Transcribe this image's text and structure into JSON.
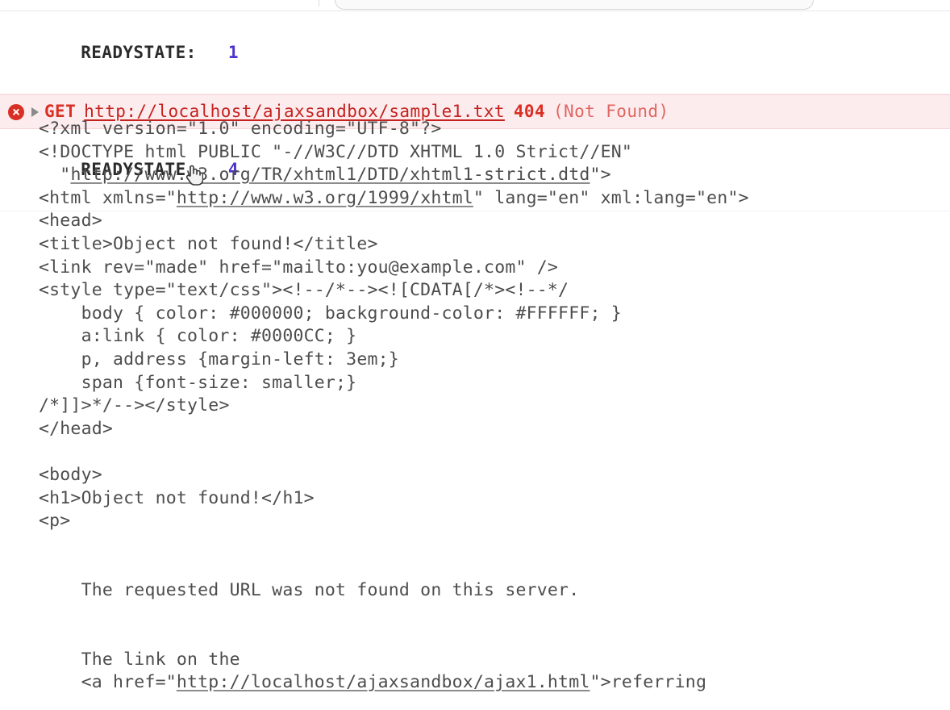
{
  "toolbar": {
    "filter_input_value": "",
    "filter_input_placeholder": ""
  },
  "console": {
    "rows": [
      {
        "type": "log",
        "label": "READYSTATE:",
        "value": "1"
      },
      {
        "type": "error",
        "icon": "error-circle-icon",
        "disclosure": "disclosure-triangle-icon",
        "method": "GET",
        "url": "http://localhost/ajaxsandbox/sample1.txt",
        "status_code": "404",
        "status_text": "(Not Found)"
      },
      {
        "type": "log",
        "label": "READYSTATE:",
        "value": "4"
      }
    ]
  },
  "source_dump": {
    "lines": [
      {
        "text": "<?xml version=\"1.0\" encoding=\"UTF-8\"?>"
      },
      {
        "text": "<!DOCTYPE html PUBLIC \"-//W3C//DTD XHTML 1.0 Strict//EN\""
      },
      {
        "pre": "  \"",
        "link": "http://www.w3.org/TR/xhtml1/DTD/xhtml1-strict.dtd",
        "post": "\">"
      },
      {
        "pre": "<html xmlns=\"",
        "link": "http://www.w3.org/1999/xhtml",
        "post": "\" lang=\"en\" xml:lang=\"en\">"
      },
      {
        "text": "<head>"
      },
      {
        "text": "<title>Object not found!</title>"
      },
      {
        "text": "<link rev=\"made\" href=\"mailto:you@example.com\" />"
      },
      {
        "text": "<style type=\"text/css\"><!--/*--><![CDATA[/*><!--*/"
      },
      {
        "text": "    body { color: #000000; background-color: #FFFFFF; }"
      },
      {
        "text": "    a:link { color: #0000CC; }"
      },
      {
        "text": "    p, address {margin-left: 3em;}"
      },
      {
        "text": "    span {font-size: smaller;}"
      },
      {
        "text": "/*]]>*/--></style>"
      },
      {
        "text": "</head>"
      },
      {
        "text": ""
      },
      {
        "text": "<body>"
      },
      {
        "text": "<h1>Object not found!</h1>"
      },
      {
        "text": "<p>"
      },
      {
        "text": ""
      },
      {
        "text": ""
      },
      {
        "text": "    The requested URL was not found on this server."
      },
      {
        "text": ""
      },
      {
        "text": ""
      },
      {
        "text": "    The link on the"
      },
      {
        "pre": "    <a href=\"",
        "link": "http://localhost/ajaxsandbox/ajax1.html",
        "post": "\">referring"
      }
    ]
  },
  "cursor": {
    "type": "pointer-hand-cursor"
  },
  "colors": {
    "error_bg": "#fdecee",
    "error_border": "#fbd2d7",
    "error_red": "#d93025",
    "link_red": "#c5221f",
    "number_blue": "#4a35cc",
    "source_text": "#4d4d4d"
  }
}
